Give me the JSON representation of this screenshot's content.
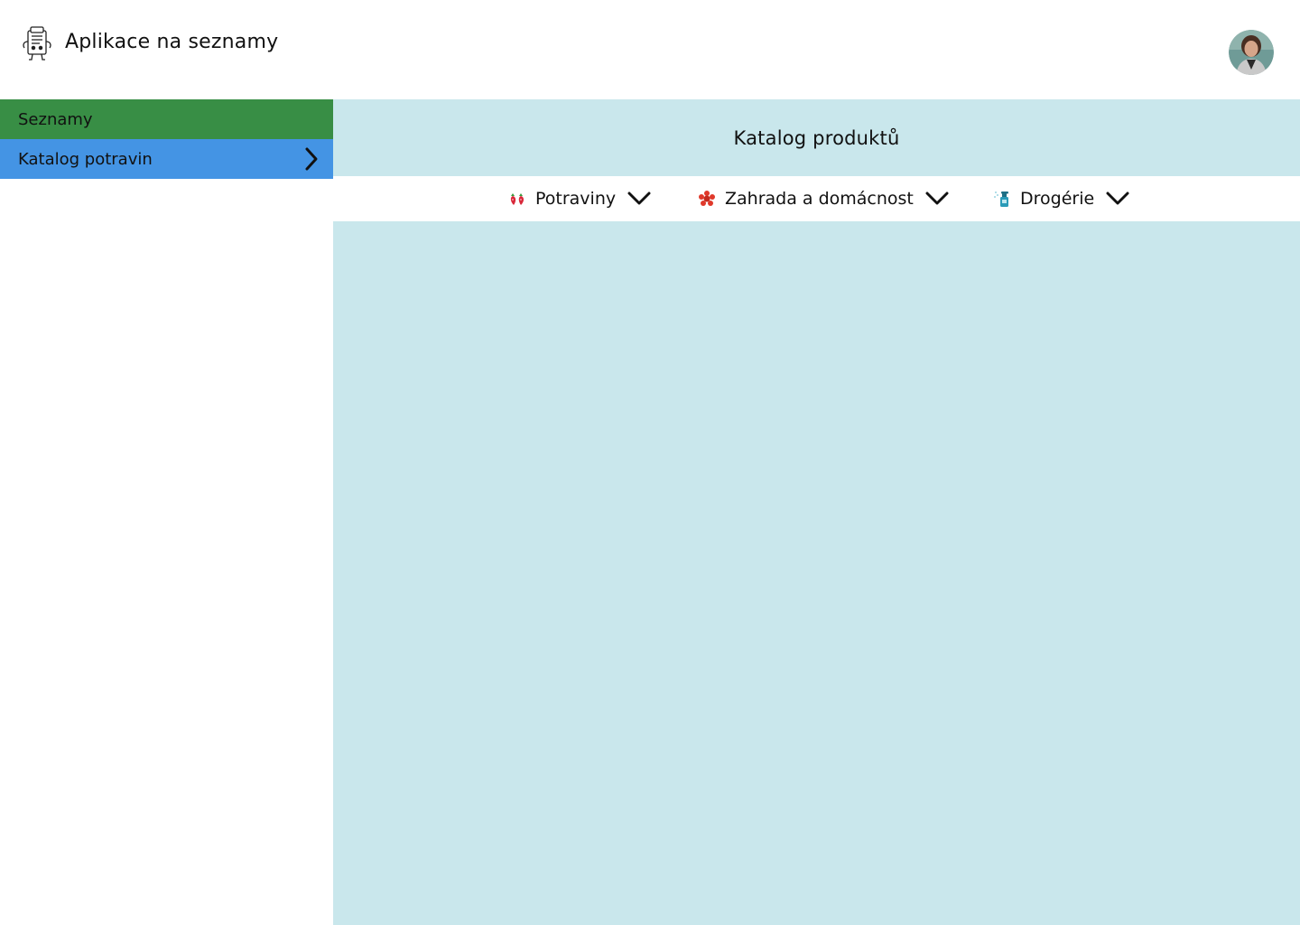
{
  "header": {
    "app_title": "Aplikace na seznamy",
    "logo_icon": "shopping-list-robot-icon",
    "avatar_icon": "user-avatar"
  },
  "sidebar": {
    "items": [
      {
        "label": "Seznamy",
        "color": "#388e45"
      },
      {
        "label": "Katalog potravin",
        "color": "#4494e4",
        "icon": "chevron-right-icon",
        "active": true
      }
    ]
  },
  "main": {
    "title": "Katalog produktů",
    "background": "#c9e7ec",
    "categories": [
      {
        "label": "Potraviny",
        "icon": "strawberries-icon"
      },
      {
        "label": "Zahrada a domácnost",
        "icon": "red-flower-icon"
      },
      {
        "label": "Drogérie",
        "icon": "spray-bottle-icon"
      }
    ]
  }
}
